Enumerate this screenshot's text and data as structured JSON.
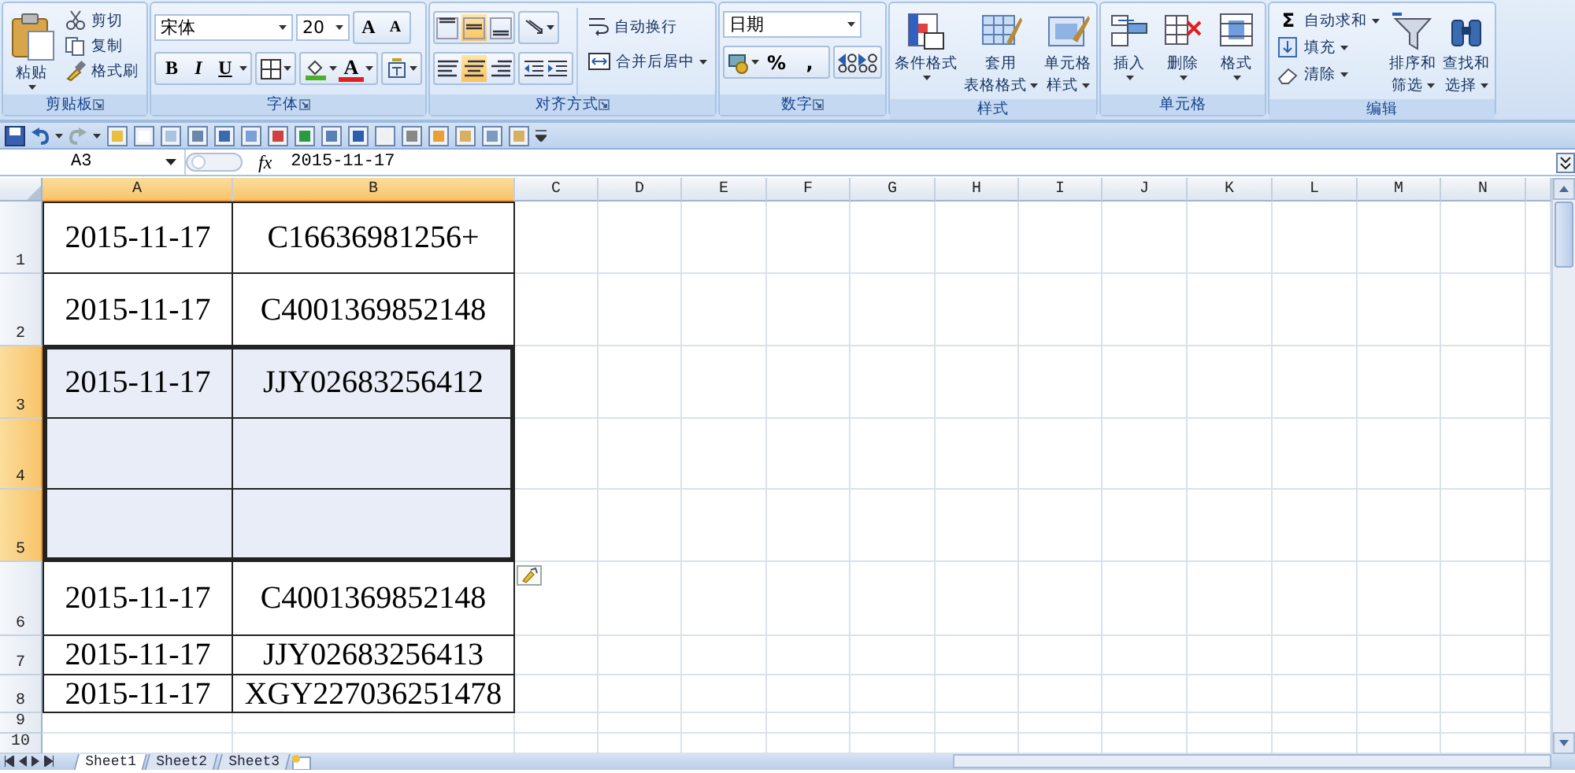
{
  "ribbon": {
    "groups": [
      {
        "kind": "clipboard",
        "label": "剪贴板",
        "paste": "粘贴",
        "actions": [
          "剪切",
          "复制",
          "格式刷"
        ]
      },
      {
        "kind": "font",
        "label": "字体",
        "font_name": "宋体",
        "font_size": "20",
        "grow": "A",
        "shrink": "A",
        "styles": [
          "B",
          "I",
          "U"
        ],
        "font_color": "A"
      },
      {
        "kind": "alignment",
        "label": "对齐方式",
        "vertical": [
          {
            "selected": false
          },
          {
            "selected": true
          },
          {
            "selected": false
          }
        ],
        "horizontal": [
          {
            "selected": false
          },
          {
            "selected": true
          },
          {
            "selected": false
          }
        ],
        "wrap": "自动换行",
        "merge": "合并后居中"
      },
      {
        "kind": "number",
        "label": "数字",
        "format": "日期",
        "symbols": [
          "%",
          ","
        ]
      },
      {
        "kind": "styles",
        "label": "样式",
        "buttons": [
          {
            "lines": [
              "条件格式"
            ]
          },
          {
            "lines": [
              "套用",
              "表格格式"
            ]
          },
          {
            "lines": [
              "单元格",
              "样式"
            ]
          }
        ]
      },
      {
        "kind": "cells",
        "label": "单元格",
        "buttons": [
          {
            "lines": [
              "插入"
            ]
          },
          {
            "lines": [
              "删除"
            ]
          },
          {
            "lines": [
              "格式"
            ]
          }
        ]
      },
      {
        "kind": "editing",
        "label": "编辑",
        "actions": [
          {
            "symbol": "Σ",
            "label": "自动求和"
          },
          {
            "label": "填充"
          },
          {
            "label": "清除"
          }
        ],
        "buttons": [
          {
            "lines": [
              "排序和",
              "筛选"
            ]
          },
          {
            "lines": [
              "查找和",
              "选择"
            ]
          }
        ]
      }
    ]
  },
  "formula_bar": {
    "name_box": "A3",
    "fx": "fx",
    "value": "2015-11-17"
  },
  "sheet": {
    "columns": [
      {
        "label": "A",
        "selected": true
      },
      {
        "label": "B",
        "selected": true
      },
      {
        "label": "C",
        "selected": false
      },
      {
        "label": "D",
        "selected": false
      },
      {
        "label": "E",
        "selected": false
      },
      {
        "label": "F",
        "selected": false
      },
      {
        "label": "G",
        "selected": false
      },
      {
        "label": "H",
        "selected": false
      },
      {
        "label": "I",
        "selected": false
      },
      {
        "label": "J",
        "selected": false
      },
      {
        "label": "K",
        "selected": false
      },
      {
        "label": "L",
        "selected": false
      },
      {
        "label": "M",
        "selected": false
      },
      {
        "label": "N",
        "selected": false
      }
    ],
    "rows": [
      {
        "number": "1",
        "selected": false,
        "bordered": true,
        "cells": [
          "2015-11-17",
          "C16636981256+"
        ]
      },
      {
        "number": "2",
        "selected": false,
        "bordered": true,
        "cells": [
          "2015-11-17",
          "C4001369852148"
        ]
      },
      {
        "number": "3",
        "selected": true,
        "bordered": true,
        "cells": [
          "2015-11-17",
          "JJY02683256412"
        ]
      },
      {
        "number": "4",
        "selected": true,
        "bordered": true
      },
      {
        "number": "5",
        "selected": true,
        "bordered": true
      },
      {
        "number": "6",
        "selected": false,
        "bordered": true,
        "cells": [
          "2015-11-17",
          "C4001369852148"
        ]
      },
      {
        "number": "7",
        "selected": false,
        "bordered": true,
        "cells": [
          "2015-11-17",
          "JJY02683256413"
        ]
      },
      {
        "number": "8",
        "selected": false,
        "bordered": true,
        "cells": [
          "2015-11-17",
          "XGY227036251478"
        ]
      },
      {
        "number": "9",
        "selected": false,
        "bordered": false
      },
      {
        "number": "10",
        "selected": false,
        "bordered": false
      }
    ]
  },
  "sheet_tabs": [
    {
      "label": "Sheet1",
      "selected": true
    },
    {
      "label": "Sheet2",
      "selected": false
    },
    {
      "label": "Sheet3",
      "selected": false
    }
  ]
}
